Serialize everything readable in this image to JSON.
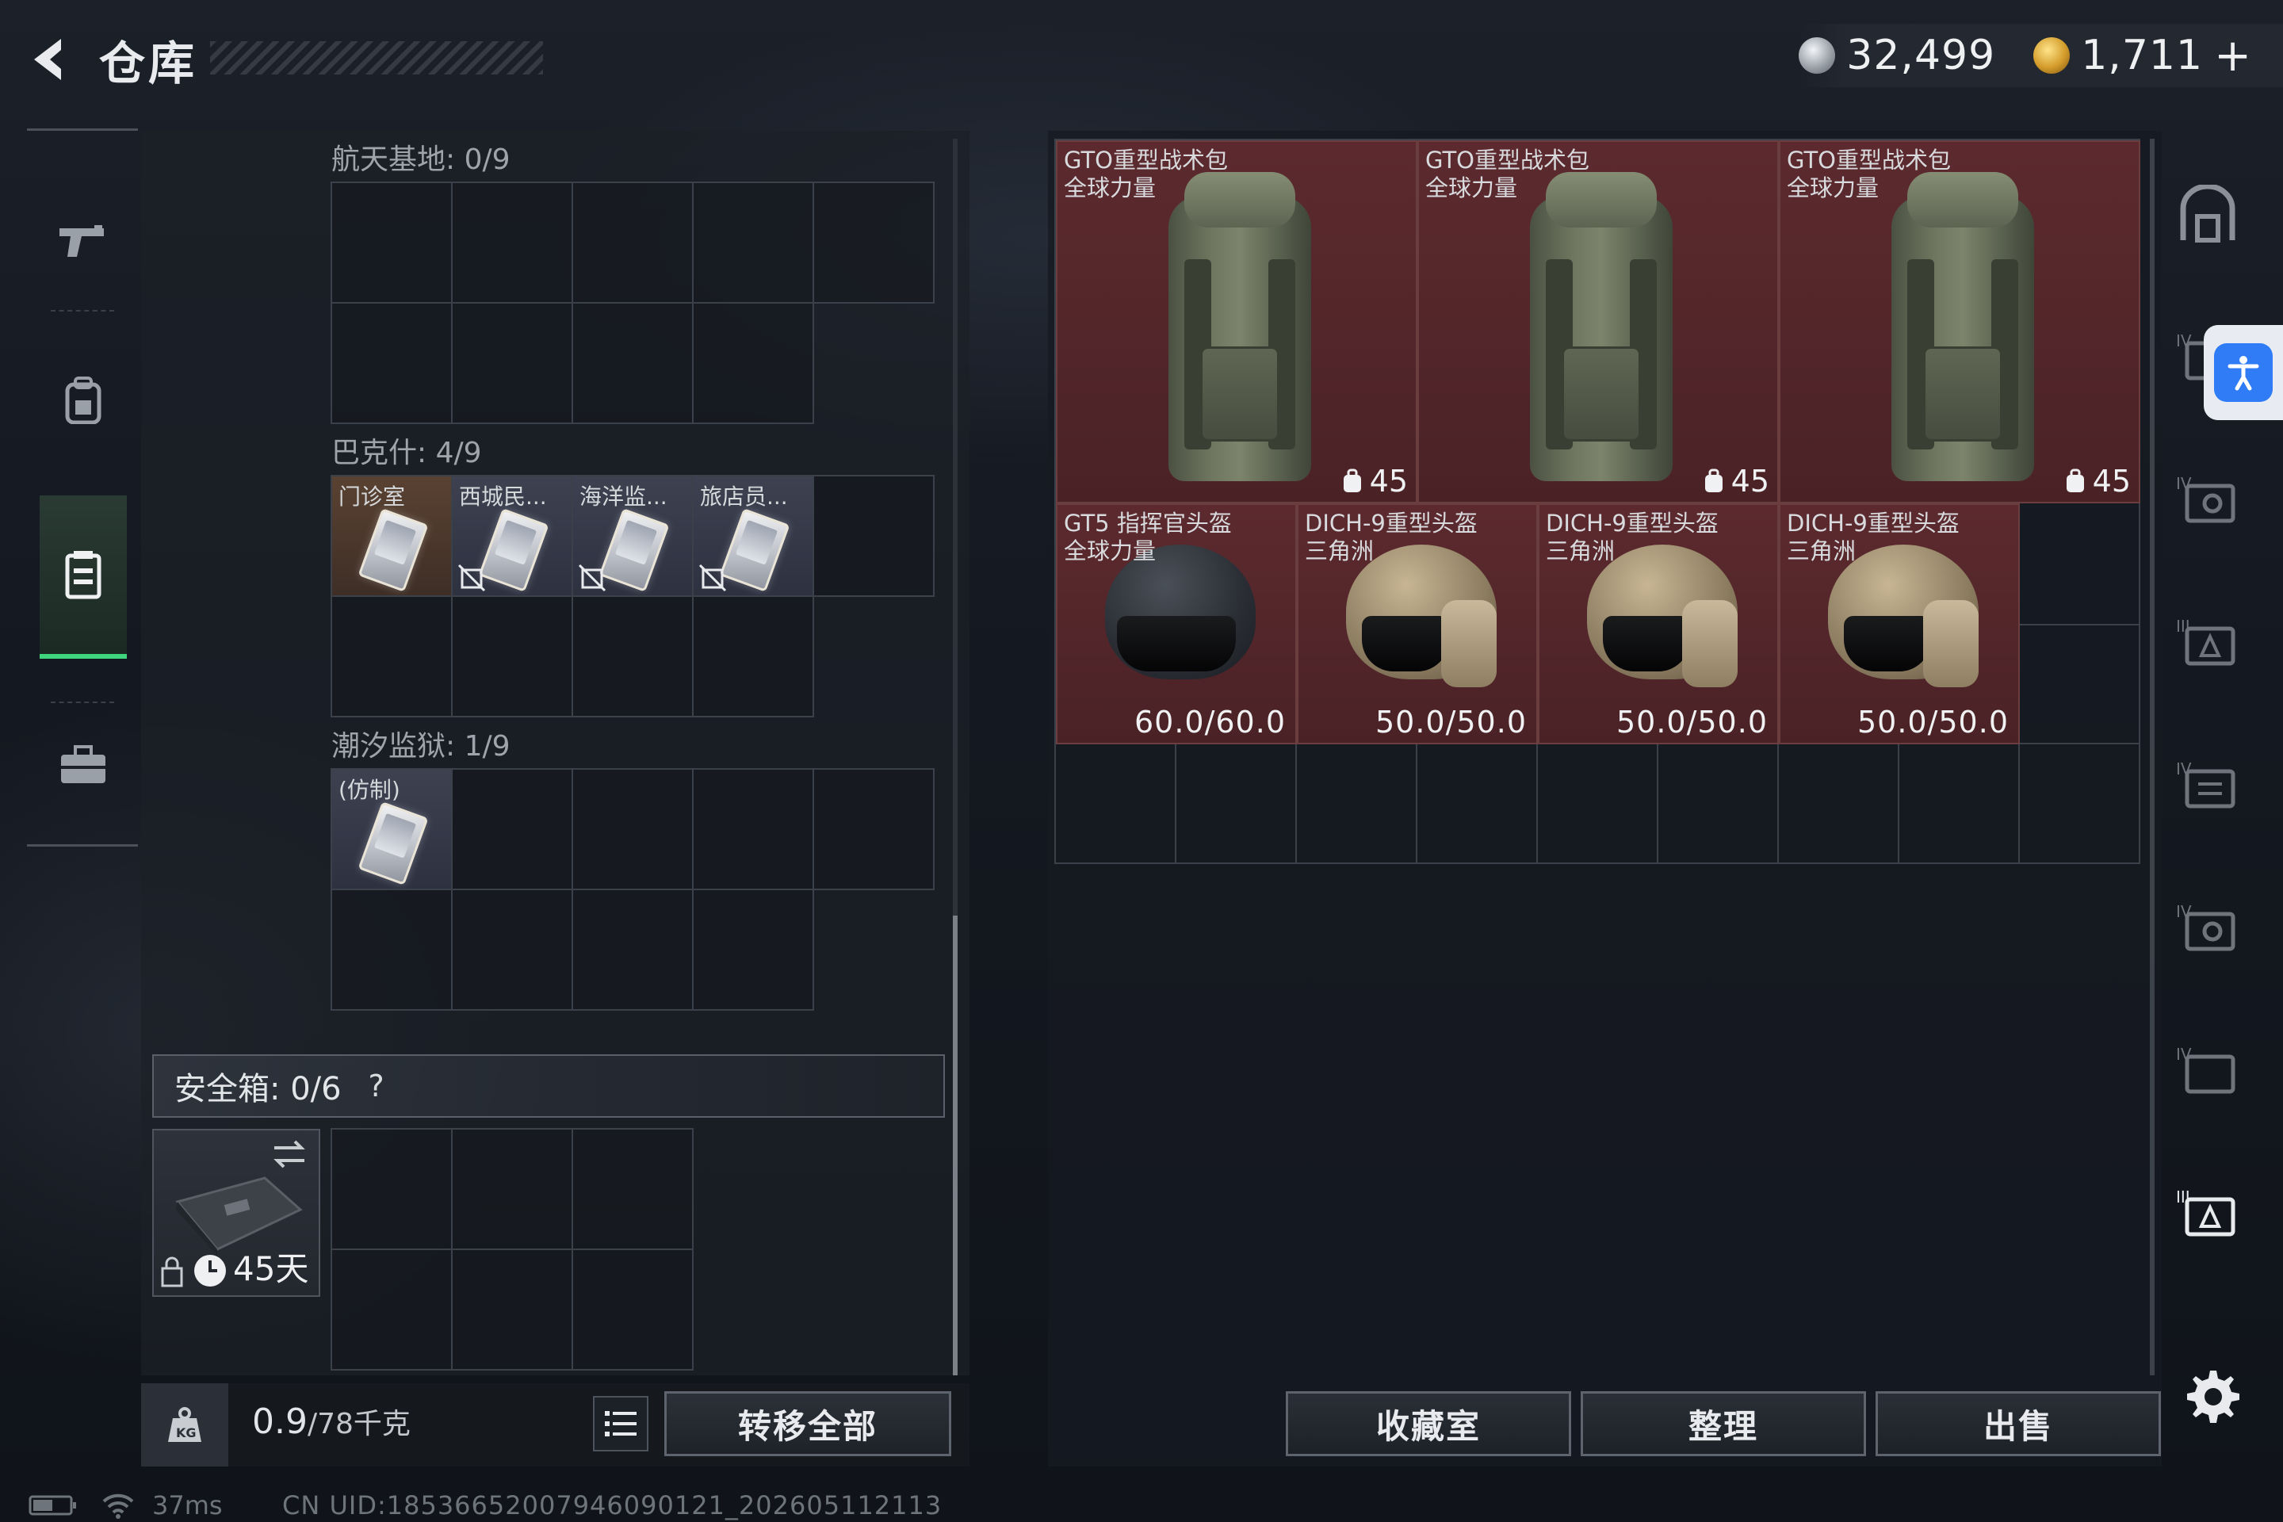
{
  "header": {
    "title": "仓库",
    "silver": "32,499",
    "gold": "1,711",
    "plus": "+"
  },
  "nav": [
    "gun-icon",
    "backpack-icon",
    "vest-icon",
    "briefcase-icon"
  ],
  "sections": [
    {
      "label": "航天基地: 0/9",
      "items": []
    },
    {
      "label": "巴克什: 4/9",
      "items": [
        {
          "name": "门诊室"
        },
        {
          "name": "西城民..."
        },
        {
          "name": "海洋监..."
        },
        {
          "name": "旅店员..."
        }
      ]
    },
    {
      "label": "潮汐监狱: 1/9",
      "items": [
        {
          "name": "(仿制)"
        }
      ]
    }
  ],
  "safe": {
    "label": "安全箱: 0/6",
    "help": "?",
    "days": "45天"
  },
  "footer": {
    "weight": "0.9",
    "weight_max": "/78千克",
    "transfer": "转移全部"
  },
  "bags": [
    {
      "label1": "GTO重型战术包",
      "label2": "全球力量",
      "weight": "45"
    },
    {
      "label1": "GTO重型战术包",
      "label2": "全球力量",
      "weight": "45"
    },
    {
      "label1": "GTO重型战术包",
      "label2": "全球力量",
      "weight": "45"
    }
  ],
  "helmets": [
    {
      "label1": "GT5 指挥官头盔",
      "label2": "全球力量",
      "dur": "60.0/60.0"
    },
    {
      "label1": "DICH-9重型头盔",
      "label2": "三角洲",
      "dur": "50.0/50.0"
    },
    {
      "label1": "DICH-9重型头盔",
      "label2": "三角洲",
      "dur": "50.0/50.0"
    },
    {
      "label1": "DICH-9重型头盔",
      "label2": "三角洲",
      "dur": "50.0/50.0"
    }
  ],
  "buttons": {
    "collection": "收藏室",
    "sort": "整理",
    "sell": "出售"
  },
  "status": {
    "ping": "37ms",
    "uid": "CN UID:18536652007946090121_202605112113"
  },
  "colors": {
    "accent_green": "#3fd47e",
    "item_red": "#5c2a2e",
    "access_blue": "#2f7cf6"
  }
}
